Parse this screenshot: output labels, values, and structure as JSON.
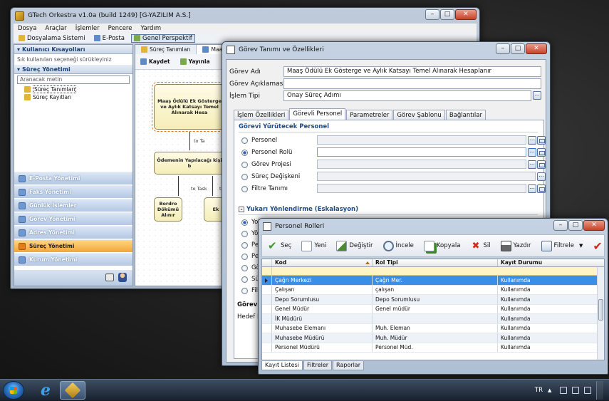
{
  "main_window": {
    "title": "GTech Orkestra v1.0a (build 1249) [G-YAZILIM A.S.]",
    "menu": [
      "Dosya",
      "Araçlar",
      "İşlemler",
      "Pencere",
      "Yardım"
    ],
    "toolbar": [
      "Dosyalama Sistemi",
      "E-Posta",
      "Genel Perspektif"
    ],
    "left_pane": {
      "shortcuts_header": "Kullanıcı Kısayolları",
      "shortcuts_hint": "Sık kullanılan seçeneği sürükleyiniz",
      "process_header": "Süreç Yönetimi",
      "search_placeholder": "Aranacak metin",
      "tree": [
        "Süreç Tanımları",
        "Süreç Kayıtları"
      ],
      "nav": [
        "E-Posta Yönetimi",
        "Faks Yönetimi",
        "Günlük İşlemler",
        "Görev Yönetimi",
        "Adres Yönetimi",
        "Süreç Yönetimi",
        "Kurum Yönetimi"
      ],
      "active_nav_index": 5
    },
    "canvas": {
      "tabs": [
        "Süreç Tanımları",
        "Maaş Ödül"
      ],
      "toolbar": [
        "Kaydet",
        "Yayınla"
      ],
      "nodes": [
        "Maaş Ödülü Ek Gösterge ve Aylık Katsayı Temel Alınarak Hesa",
        "Ödemenin Yapılacağı kişi b",
        "Bordro Dökümü Alınır",
        "Ek"
      ],
      "edge_labels": [
        "to Ta",
        "to Task",
        "to"
      ]
    }
  },
  "task_dialog": {
    "title": "Görev Tanımı ve Özellikleri",
    "labels": {
      "name": "Görev Adı",
      "description": "Görev Açıklaması",
      "type": "İşlem Tipi"
    },
    "values": {
      "name": "Maaş Ödülü Ek Gösterge ve Aylık Katsayı Temel Alınarak Hesaplanır",
      "description": "",
      "type": "Onay Süreç Adımı"
    },
    "tabs": [
      "İşlem Özellikleri",
      "Görevli Personel",
      "Parametreler",
      "Görev Şablonu",
      "Bağlantılar"
    ],
    "active_tab_index": 1,
    "assignee_section": "Görevi Yürütecek Personel",
    "assignee_options": [
      "Personel",
      "Personel Rolü",
      "Görev Projesi",
      "Süreç Değişkeni",
      "Filtre Tanımı"
    ],
    "assignee_selected_index": 1,
    "escalation_section": "Yukarı Yönlendirme (Eskalasyon)",
    "escalation_options": [
      "Yok",
      "Yön",
      "Pers",
      "Pers",
      "Gör",
      "Süre",
      "Filtr"
    ],
    "escalation_selected_index": 0,
    "footer_labels": [
      "Görevi Y",
      "Hedef De"
    ]
  },
  "roles_dialog": {
    "title": "Personel Rolleri",
    "toolbar": [
      "Seç",
      "Yeni",
      "Değiştir",
      "İncele",
      "Kopyala",
      "Sil",
      "Yazdır",
      "Filtrele"
    ],
    "columns": [
      "Kod",
      "Rol Tipi",
      "Kayıt Durumu"
    ],
    "rows": [
      [
        "Çağrı Merkezi",
        "Çağrı Mer.",
        "Kullanımda"
      ],
      [
        "Çalışan",
        "çalışan",
        "Kullanımda"
      ],
      [
        "Depo Sorumlusu",
        "Depo Sorumlusu",
        "Kullanımda"
      ],
      [
        "Genel Müdür",
        "Genel müdür",
        "Kullanımda"
      ],
      [
        "İK Müdürü",
        "",
        "Kullanımda"
      ],
      [
        "Muhasebe Elemanı",
        "Muh. Eleman",
        "Kullanımda"
      ],
      [
        "Muhasebe Müdürü",
        "Muh. Müdür",
        "Kullanımda"
      ],
      [
        "Personel Müdürü",
        "Personel Müd.",
        "Kullanımda"
      ]
    ],
    "selected_row_index": 0,
    "bottom_tabs": [
      "Kayıt Listesi",
      "Filtreler",
      "Raporlar"
    ]
  },
  "taskbar": {
    "language": "TR"
  },
  "colors": {
    "selection": "#3a8ee6",
    "active_nav": "#f4a53a",
    "section_title": "#1d4a8a"
  }
}
